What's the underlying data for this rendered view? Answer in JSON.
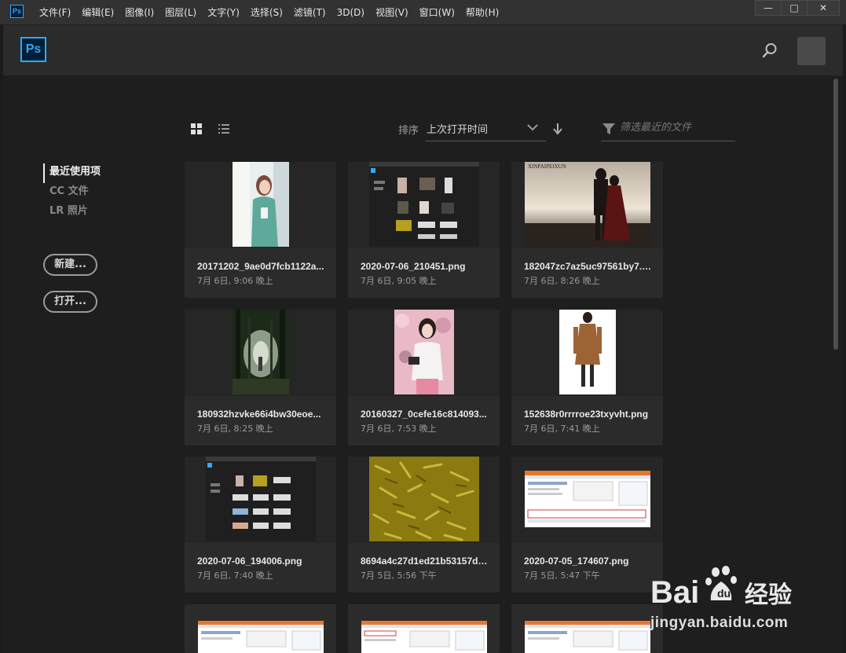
{
  "app": {
    "small_logo": "Ps",
    "logo": "Ps"
  },
  "menu": [
    "文件(F)",
    "编辑(E)",
    "图像(I)",
    "图层(L)",
    "文字(Y)",
    "选择(S)",
    "滤镜(T)",
    "3D(D)",
    "视图(V)",
    "窗口(W)",
    "帮助(H)"
  ],
  "window_controls": {
    "minimize": "—",
    "maximize": "□",
    "close": "✕"
  },
  "sidebar": {
    "items": [
      {
        "label": "最近使用项",
        "active": true
      },
      {
        "label": "CC 文件",
        "active": false
      },
      {
        "label": "LR 照片",
        "active": false
      }
    ],
    "new_button": "新建...",
    "open_button": "打开..."
  },
  "toolbar": {
    "sort_label": "排序",
    "sort_value": "上次打开时间",
    "filter_placeholder": "筛选最近的文件"
  },
  "files": [
    {
      "name": "20171202_9ae0d7fcb1122a...",
      "date": "7月 6日, 9:06 晚上",
      "thumb": "portrait-green-dress"
    },
    {
      "name": "2020-07-06_210451.png",
      "date": "7月 6日, 9:05 晚上",
      "thumb": "ps-screenshot-dark"
    },
    {
      "name": "182047zc7az5uc97561by7.jpg",
      "date": "7月 6日, 8:26 晚上",
      "thumb": "couple-silhouette"
    },
    {
      "name": "180932hzvke66i4bw30eoe...",
      "date": "7月 6日, 8:25 晚上",
      "thumb": "forest-light"
    },
    {
      "name": "20160327_0cefe16c814093...",
      "date": "7月 6日, 7:53 晚上",
      "thumb": "girl-camera-blossoms"
    },
    {
      "name": "152638r0rrrroe23txyvht.png",
      "date": "7月 6日, 7:41 晚上",
      "thumb": "woman-brown-coat"
    },
    {
      "name": "2020-07-06_194006.png",
      "date": "7月 6日, 7:40 晚上",
      "thumb": "ps-screenshot-dark"
    },
    {
      "name": "8694a4c27d1ed21b53157d9...",
      "date": "7月 5日, 5:56 下午",
      "thumb": "gold-texture"
    },
    {
      "name": "2020-07-05_174607.png",
      "date": "7月 5日, 5:47 下午",
      "thumb": "web-form-screenshot"
    },
    {
      "name": "",
      "date": "",
      "thumb": "web-form-screenshot"
    },
    {
      "name": "",
      "date": "",
      "thumb": "web-form-screenshot"
    },
    {
      "name": "",
      "date": "",
      "thumb": "web-form-screenshot"
    }
  ],
  "watermark": {
    "brand": "Bai",
    "cn": "经验",
    "url": "jingyan.baidu.com"
  },
  "colors": {
    "accent": "#31a8ff",
    "background": "#1e1e1e",
    "card": "#2b2b2b"
  }
}
